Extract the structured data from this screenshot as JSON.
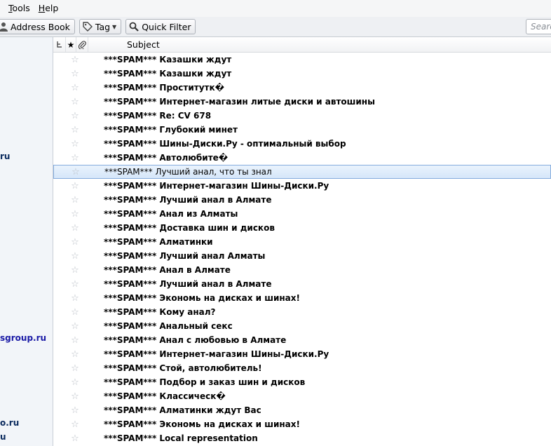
{
  "menubar": {
    "items": [
      {
        "label": "Tools",
        "mnemonic": "T",
        "rest": "ools"
      },
      {
        "label": "Help",
        "mnemonic": "H",
        "rest": "elp"
      }
    ]
  },
  "toolbar": {
    "address_book_label": "Address Book",
    "tag_label": "Tag",
    "quick_filter_label": "Quick Filter",
    "search_placeholder": "Search"
  },
  "folders": [
    {
      "label": "ru"
    },
    {
      "label": "sgroup.ru"
    },
    {
      "label": "o.ru"
    },
    {
      "label": "u"
    }
  ],
  "thread_header": {
    "subject_label": "Subject"
  },
  "messages": [
    {
      "subject": "***SPAM*** Казашки ждут"
    },
    {
      "subject": "***SPAM*** Казашки ждут"
    },
    {
      "subject": "***SPAM*** Проститутк�"
    },
    {
      "subject": "***SPAM*** Интернет-магазин литые диски и автошины"
    },
    {
      "subject": "***SPAM*** Re: CV  678"
    },
    {
      "subject": "***SPAM*** Глубокий минет"
    },
    {
      "subject": "***SPAM*** Шины-Диски.Ру - оптимальный выбор"
    },
    {
      "subject": "***SPAM*** Автолюбите�"
    },
    {
      "subject": "***SPAM*** Лучший анал, что ты знал",
      "selected": true
    },
    {
      "subject": "***SPAM*** Интернет-магазин Шины-Диски.Ру"
    },
    {
      "subject": "***SPAM*** Лучший анал в Алмате"
    },
    {
      "subject": "***SPAM*** Анал из Алматы"
    },
    {
      "subject": "***SPAM*** Доставка шин и дисков"
    },
    {
      "subject": "***SPAM*** Алматинки"
    },
    {
      "subject": "***SPAM*** Лучший анал Алматы"
    },
    {
      "subject": "***SPAM*** Анал в Алмате"
    },
    {
      "subject": "***SPAM*** Лучший анал в Алмате"
    },
    {
      "subject": "***SPAM*** Экономь на дисках и шинах!"
    },
    {
      "subject": "***SPAM*** Кому анал?"
    },
    {
      "subject": "***SPAM*** Анальный секс"
    },
    {
      "subject": "***SPAM*** Анал с любовью в Алмате"
    },
    {
      "subject": "***SPAM*** Интернет-магазин Шины-Диски.Ру"
    },
    {
      "subject": "***SPAM*** Стой, автолюбитель!"
    },
    {
      "subject": "***SPAM*** Подбор и заказ шин и дисков"
    },
    {
      "subject": "***SPAM*** Классическ�"
    },
    {
      "subject": "***SPAM*** Алматинки ждут Вас"
    },
    {
      "subject": "***SPAM*** Экономь на дисках и шинах!"
    },
    {
      "subject": "***SPAM*** Local representation"
    }
  ]
}
